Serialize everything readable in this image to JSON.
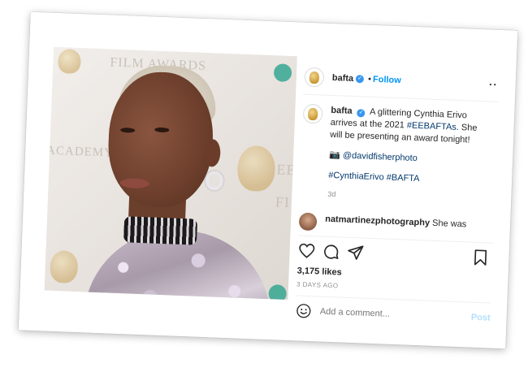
{
  "post": {
    "username": "bafta",
    "verified_mark": "✓",
    "separator": "•",
    "follow_label": "Follow",
    "more_label": "··",
    "caption": {
      "username": "bafta",
      "text_before": "A glittering Cynthia Erivo arrives at the 2021 ",
      "hashtag_inline": "#EEBAFTAs",
      "text_after": ". She will be presenting an award tonight!",
      "camera_emoji": "📷",
      "photo_credit": "@davidfisherphoto",
      "hashtag_1": "#CynthiaErivo",
      "hashtag_2": "#BAFTA",
      "age": "3d"
    },
    "comment": {
      "username": "natmartinezphotography",
      "text": "She was"
    },
    "likes": "3,175 likes",
    "date": "3 DAYS AGO",
    "add_comment_placeholder": "Add a comment...",
    "post_label": "Post"
  },
  "photo_backdrop": {
    "text_1": "FILM AWARDS",
    "text_2": "ACADEMY",
    "text_3": "EE",
    "text_4": "FI"
  },
  "icons": {
    "avatar": "bafta-mask-icon",
    "like": "heart-icon",
    "comment": "comment-bubble-icon",
    "share": "paper-plane-icon",
    "save": "bookmark-icon",
    "emoji": "smiley-icon",
    "more": "more-dots-icon"
  },
  "colors": {
    "link_blue": "#0095f6",
    "hashtag_navy": "#00376b",
    "verified_blue": "#3897f0",
    "muted_gray": "#8e8e8e",
    "post_disabled": "#b2dffc"
  }
}
